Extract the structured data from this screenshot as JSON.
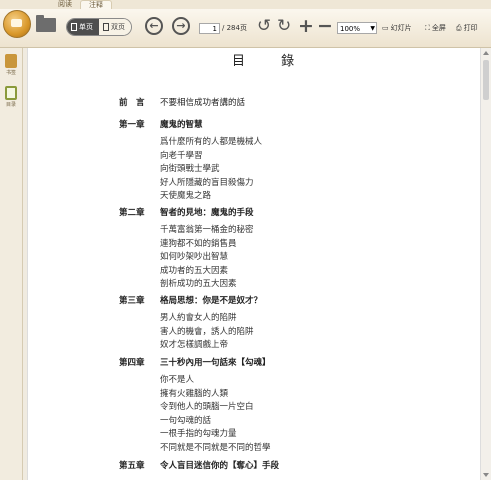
{
  "tabs": [
    "阅读",
    "注释"
  ],
  "toolbar": {
    "single_page": "单页",
    "double_page": "双页",
    "current_page": "1",
    "total_pages": "/ 284页",
    "zoom": "100%",
    "slideshow": "幻灯片",
    "fullscreen": "全屏",
    "print": "打印"
  },
  "sidebar": {
    "items": [
      "书签",
      "目录"
    ]
  },
  "doc": {
    "title": "目 錄",
    "toc": [
      {
        "chapter": "前　言",
        "title": "不要相信成功者講的話",
        "sections": []
      },
      {
        "chapter": "第一章",
        "title": "魔鬼的智慧",
        "sections": [
          "爲什麼所有的人都是機械人",
          "向老千學習",
          "向街頭戰士學武",
          "好人所隱藏的盲目殺傷力",
          "天使魔鬼之路"
        ]
      },
      {
        "chapter": "第二章",
        "title": "智者的見地：魔鬼的手段",
        "sections": [
          "千萬富翁第一桶金的秘密",
          "連狗都不如的銷售員",
          "如何吵架吵出智慧",
          "成功者的五大因素",
          "剖析成功的五大因素"
        ]
      },
      {
        "chapter": "第三章",
        "title": "格局思想：你是不是奴才？",
        "sections": [
          "男人約會女人的陷阱",
          "害人的機會，誘人的陷阱",
          "奴才怎樣調戲上帝"
        ]
      },
      {
        "chapter": "第四章",
        "title": "三十秒內用一句話來【勾魂】",
        "sections": [
          "你不是人",
          "擁有火雞腦的人類",
          "令到他人的頭腦一片空白",
          "一句勾魂的話",
          "一根手指的勾魂力量",
          "不同就是不同就是不同的哲學"
        ]
      },
      {
        "chapter": "第五章",
        "title": "令人盲目迷信你的【奪心】手段",
        "sections": []
      }
    ]
  }
}
